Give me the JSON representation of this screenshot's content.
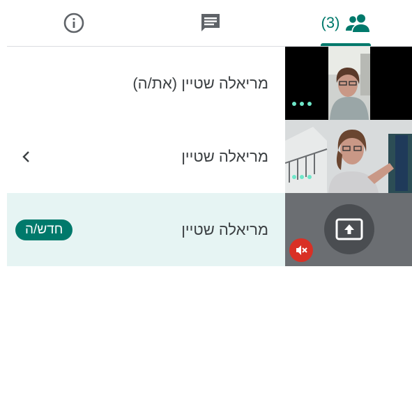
{
  "tabs": {
    "info": {
      "icon": "info-icon"
    },
    "chat": {
      "icon": "chat-icon"
    },
    "people": {
      "icon": "people-icon",
      "count": "(3)",
      "active": true
    }
  },
  "participants": [
    {
      "name": "מריאלה שטיין (את/ה)",
      "tile": "video-self"
    },
    {
      "name": "מריאלה שטיין",
      "tile": "video-person"
    },
    {
      "name": "מריאלה שטיין",
      "tile": "presentation",
      "badge": "חדש/ה",
      "muted": true
    }
  ],
  "colors": {
    "accent": "#00796b",
    "highlight_row": "#e6f4f3",
    "mute_red": "#d93025",
    "audio_dots": "#6ee7c9"
  }
}
